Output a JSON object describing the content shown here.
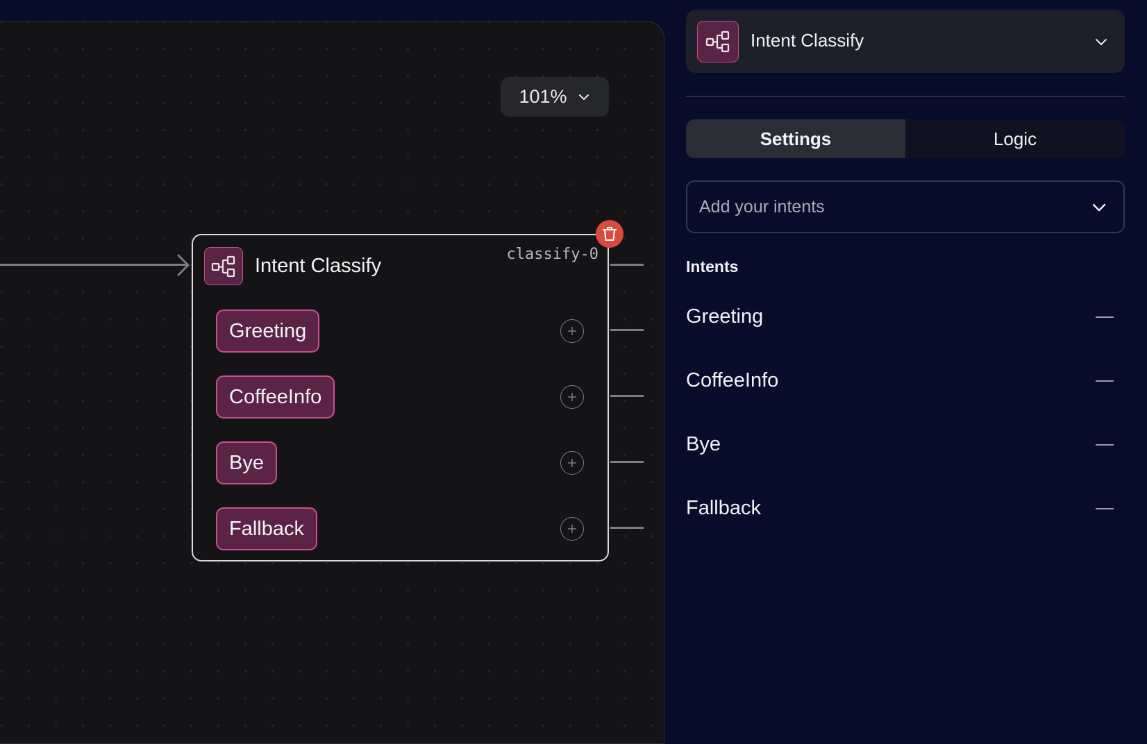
{
  "canvas": {
    "zoom_label": "101%",
    "node": {
      "title": "Intent Classify",
      "id_label": "classify-0",
      "intents": [
        "Greeting",
        "CoffeeInfo",
        "Bye",
        "Fallback"
      ]
    }
  },
  "panel": {
    "header_title": "Intent Classify",
    "tabs": {
      "settings": "Settings",
      "logic": "Logic"
    },
    "active_tab": "Settings",
    "intent_select_placeholder": "Add your intents",
    "intents_heading": "Intents",
    "intents": [
      "Greeting",
      "CoffeeInfo",
      "Bye",
      "Fallback"
    ]
  },
  "colors": {
    "accent_fill": "#5b2447",
    "accent_border": "#c94f91",
    "delete": "#d94b3e",
    "panel_bg": "#070c2b",
    "canvas_bg": "#141416"
  },
  "icons": {
    "node": "flow-branch-icon",
    "delete": "trash-icon",
    "port": "plus-circle-icon",
    "remove": "minus-icon",
    "dropdown": "chevron-down-icon"
  }
}
